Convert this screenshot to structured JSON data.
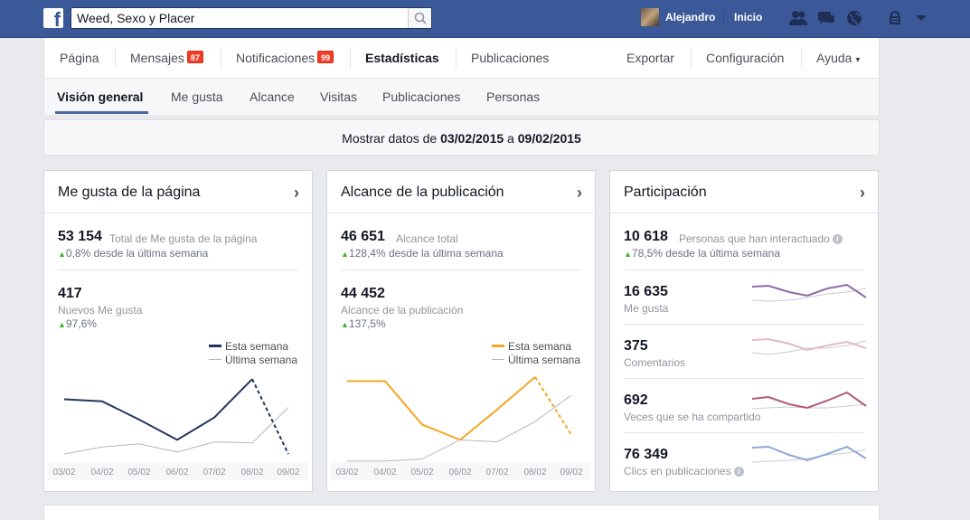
{
  "topbar": {
    "logo_letter": "f",
    "search_value": "Weed, Sexo y Placer",
    "user_name": "Alejandro",
    "home_label": "Inicio"
  },
  "tabs": {
    "pagina": "Página",
    "mensajes": "Mensajes",
    "mensajes_badge": "87",
    "notificaciones": "Notificaciones",
    "notificaciones_badge": "99",
    "estadisticas": "Estadísticas",
    "publicaciones": "Publicaciones",
    "exportar": "Exportar",
    "configuracion": "Configuración",
    "ayuda": "Ayuda",
    "ayuda_caret": "▾"
  },
  "subtabs": {
    "vision": "Visión general",
    "megusta": "Me gusta",
    "alcance": "Alcance",
    "visitas": "Visitas",
    "publicaciones": "Publicaciones",
    "personas": "Personas"
  },
  "datebar": {
    "prefix": "Mostrar datos de ",
    "from": "03/02/2015",
    "middle": " a ",
    "to": "09/02/2015"
  },
  "cards": {
    "likes": {
      "title": "Me gusta de la página",
      "total_value": "53 154",
      "total_label": "Total de Me gusta de la página",
      "total_change": "0,8% desde la última semana",
      "new_value": "417",
      "new_label": "Nuevos Me gusta",
      "new_change": "97,6%",
      "legend_this": "Esta semana",
      "legend_last": "Última semana"
    },
    "reach": {
      "title": "Alcance de la publicación",
      "total_value": "46 651",
      "total_label": "Alcance total",
      "total_change": "128,4% desde la última semana",
      "post_value": "44 452",
      "post_label": "Alcance de la publicación",
      "post_change": "137,5%",
      "legend_this": "Esta semana",
      "legend_last": "Última semana"
    },
    "engagement": {
      "title": "Participación",
      "total_value": "10 618",
      "total_label": "Personas que han interactuado",
      "total_change": "78,5% desde la última semana",
      "rows": [
        {
          "value": "16 635",
          "label": "Me gusta"
        },
        {
          "value": "375",
          "label": "Comentarios"
        },
        {
          "value": "692",
          "label": "Veces que se ha compartido"
        },
        {
          "value": "76 349",
          "label": "Clics en publicaciones"
        }
      ]
    }
  },
  "chart_data": [
    {
      "type": "line",
      "x": [
        "03/02",
        "04/02",
        "05/02",
        "06/02",
        "07/02",
        "08/02",
        "09/02"
      ],
      "ylim": [
        0,
        100
      ],
      "series": [
        {
          "name": "Esta semana",
          "color": "#23355c",
          "values": [
            62,
            60,
            42,
            22,
            44,
            82,
            8
          ]
        },
        {
          "name": "Última semana",
          "color": "#b3b7bf",
          "values": [
            8,
            15,
            18,
            10,
            20,
            19,
            54
          ]
        }
      ]
    },
    {
      "type": "line",
      "x": [
        "03/02",
        "04/02",
        "05/02",
        "06/02",
        "07/02",
        "08/02",
        "09/02"
      ],
      "ylim": [
        0,
        100
      ],
      "series": [
        {
          "name": "Esta semana",
          "color": "#f5a623",
          "values": [
            80,
            80,
            37,
            22,
            52,
            84,
            27
          ]
        },
        {
          "name": "Última semana",
          "color": "#b3b7bf",
          "values": [
            1,
            1,
            3,
            22,
            20,
            40,
            66
          ]
        }
      ]
    }
  ]
}
